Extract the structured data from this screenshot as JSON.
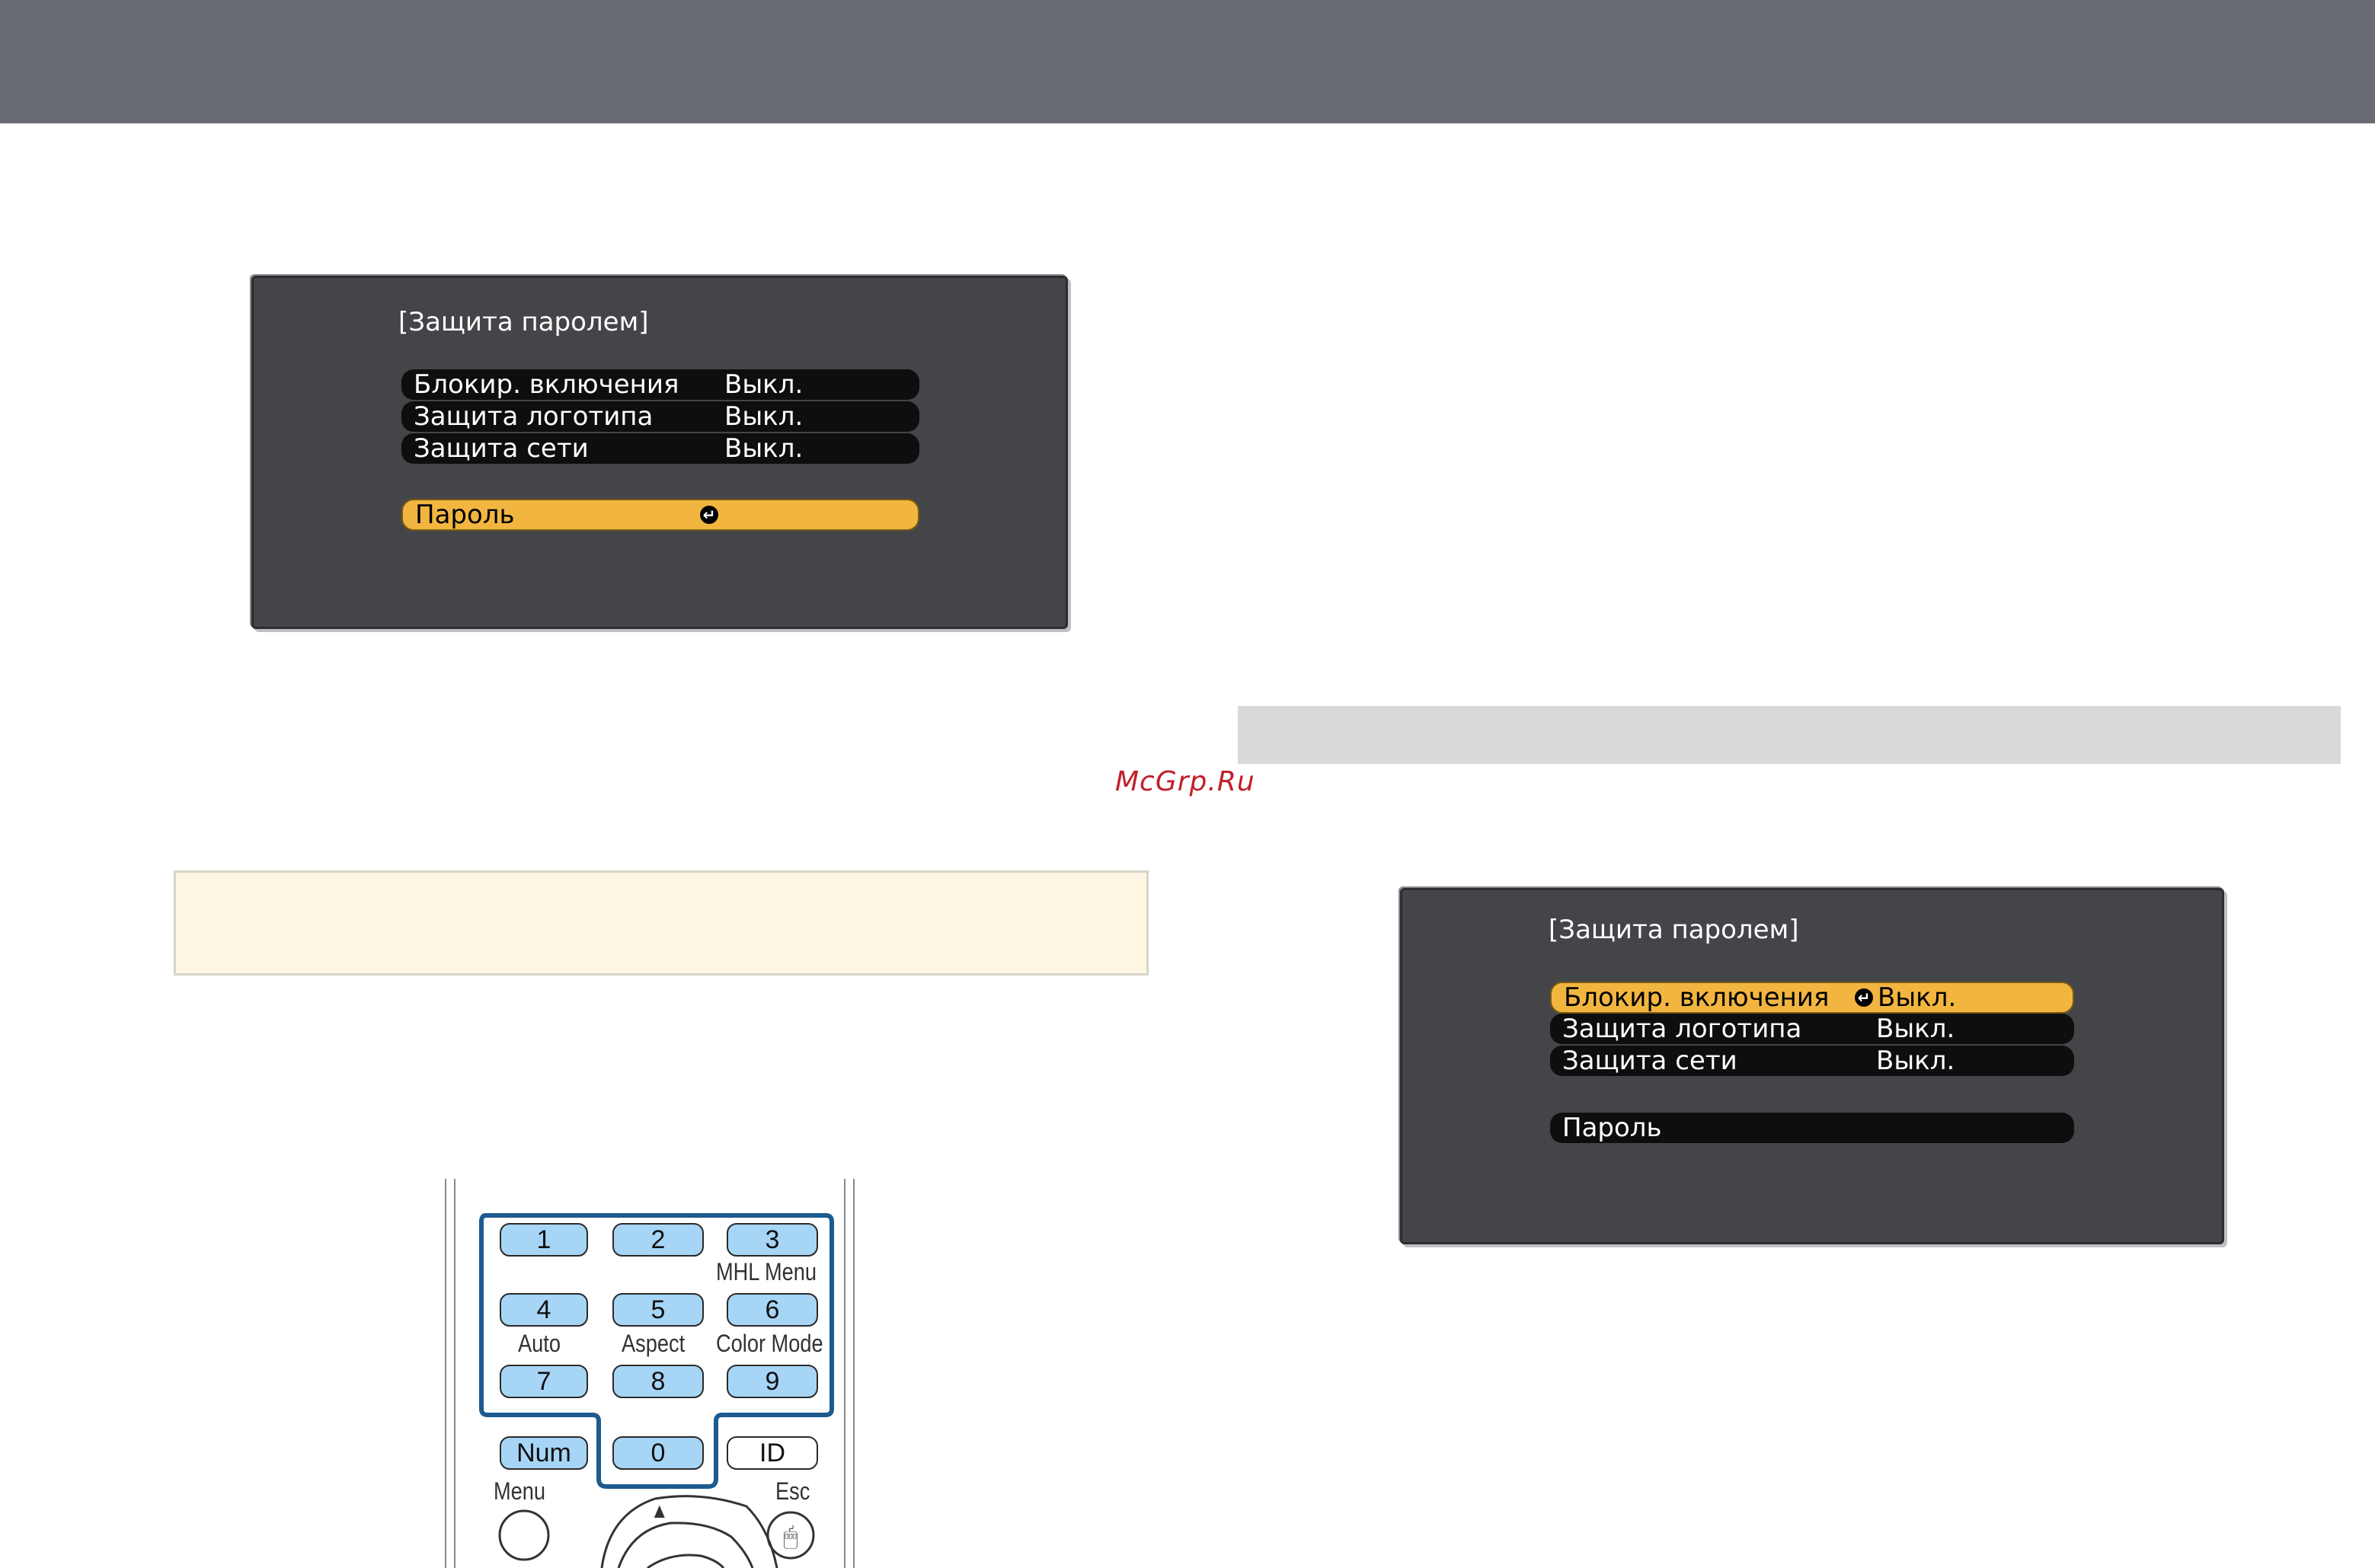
{
  "osd_left": {
    "title": "[Защита паролем]",
    "rows": [
      {
        "label": "Блокир. включения",
        "value": "Выкл."
      },
      {
        "label": "Защита логотипа",
        "value": "Выкл."
      },
      {
        "label": "Защита сети",
        "value": "Выкл."
      }
    ],
    "password_label": "Пароль"
  },
  "osd_right": {
    "title": "[Защита паролем]",
    "rows": [
      {
        "label": "Блокир. включения",
        "value": "Выкл."
      },
      {
        "label": "Защита логотипа",
        "value": "Выкл."
      },
      {
        "label": "Защита сети",
        "value": "Выкл."
      }
    ],
    "password_label": "Пароль"
  },
  "watermark": "McGrp.Ru",
  "remote": {
    "keys": {
      "k1": "1",
      "k2": "2",
      "k3": "3",
      "k4": "4",
      "k5": "5",
      "k6": "6",
      "k7": "7",
      "k8": "8",
      "k9": "9",
      "k0": "0",
      "num": "Num",
      "id": "ID"
    },
    "captions": {
      "mhl_menu": "MHL Menu",
      "auto": "Auto",
      "aspect": "Aspect",
      "color_mode": "Color Mode",
      "menu": "Menu",
      "esc": "Esc"
    },
    "up_arrow": "▲"
  },
  "colors": {
    "highlight": "#f2b640",
    "osd_bg": "#444549",
    "key_blue": "#a7d5f6",
    "outline": "#1d5a8e"
  }
}
